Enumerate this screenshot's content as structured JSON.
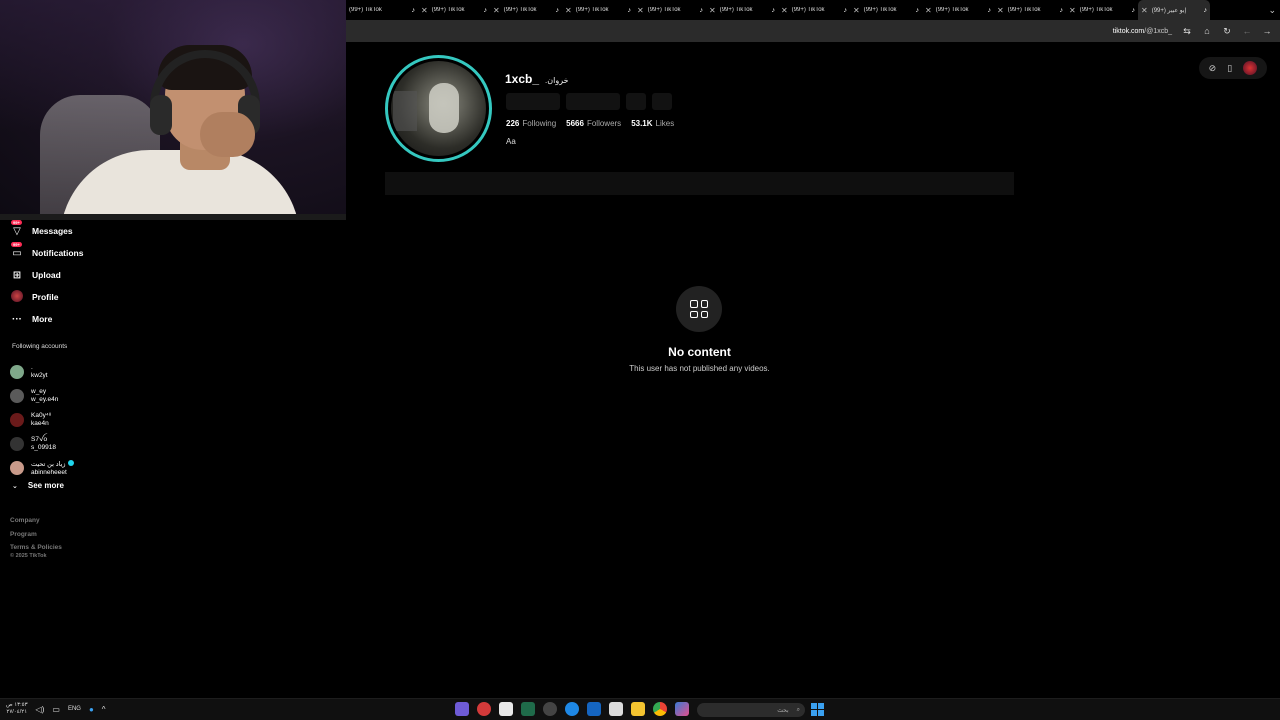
{
  "browser": {
    "tabs": [
      {
        "title": "(99+) TikTok",
        "active": false
      },
      {
        "title": "(99+) TikTok",
        "active": false
      },
      {
        "title": "(99+) TikTok",
        "active": false
      },
      {
        "title": "(99+) TikTok",
        "active": false
      },
      {
        "title": "(99+) TikTok",
        "active": false
      },
      {
        "title": "(99+) TikTok",
        "active": false
      },
      {
        "title": "(99+) TikTok",
        "active": false
      },
      {
        "title": "(99+) TikTok",
        "active": false
      },
      {
        "title": "(99+) TikTok",
        "active": false
      },
      {
        "title": "(99+) TikTok",
        "active": false
      },
      {
        "title": "(99+) TikTok",
        "active": false
      },
      {
        "title": "(99+) إبو عبير",
        "active": true
      }
    ],
    "url_domain": "tiktok.com",
    "url_path": "/@1xcb_"
  },
  "profile": {
    "username": "1xcb_",
    "nickname": ".خروان",
    "following_count": "226",
    "following_label": "Following",
    "followers_count": "5666",
    "followers_label": "Followers",
    "likes_count": "53.1K",
    "likes_label": "Likes",
    "bio": "Aa"
  },
  "empty_state": {
    "title": "No content",
    "subtitle": "This user has not published any videos."
  },
  "sidebar": {
    "nav": [
      {
        "label": "Messages",
        "icon": "messages-icon",
        "badge": "99+"
      },
      {
        "label": "Notifications",
        "icon": "notifications-icon",
        "badge": "99+"
      },
      {
        "label": "Upload",
        "icon": "upload-icon",
        "badge": ""
      },
      {
        "label": "Profile",
        "icon": "profile-avatar",
        "badge": ""
      },
      {
        "label": "More",
        "icon": "more-icon",
        "badge": ""
      }
    ],
    "following_header": "Following accounts",
    "following": [
      {
        "display": ".",
        "handle": "kw2yt",
        "color": "#7fa88a"
      },
      {
        "display": "w_ey",
        "handle": "w_ey.e4n",
        "color": "#5a5a5a"
      },
      {
        "display": "Ka0y⁴⁸",
        "handle": "kae4n",
        "color": "#6a1a1a"
      },
      {
        "display": "S7ꪜo",
        "handle": "s_09918",
        "color": "#333333"
      },
      {
        "display": "زياد بن تحيت",
        "handle": "abinneheeet",
        "color": "#c99a8a"
      }
    ],
    "see_more": "See more",
    "footer": [
      "Company",
      "Program",
      "Terms & Policies"
    ],
    "copyright": "© 2025 TikTok"
  },
  "taskbar": {
    "time": "١٣:٥٣ ص",
    "date": "٢٧/٠٤/٢١",
    "language": "ENG",
    "search_placeholder": "بحث"
  }
}
